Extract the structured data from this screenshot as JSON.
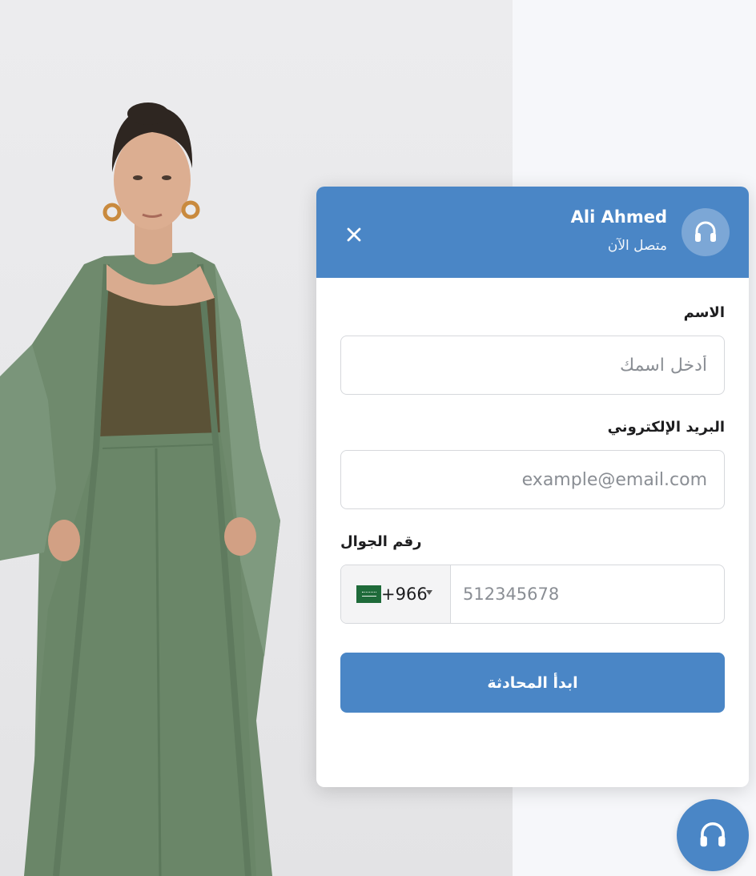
{
  "photo": {
    "icon": "model-photo",
    "colors": {
      "background": "#e8e8ea",
      "garment": "#6f8a6d",
      "top": "#5b5237",
      "skin": "#d7a98c"
    }
  },
  "chat_widget": {
    "header": {
      "agent_name": "Ali Ahmed",
      "agent_status": "متصل الآن",
      "close_icon": "close-icon",
      "avatar_icon": "headset-icon",
      "background_color": "#4a86c6"
    },
    "form": {
      "name": {
        "label": "الاسم",
        "placeholder": "أدخل اسمك",
        "value": ""
      },
      "email": {
        "label": "البريد الإلكتروني",
        "placeholder": "example@email.com",
        "value": ""
      },
      "phone": {
        "label": "رقم الجوال",
        "country_flag": "saudi-arabia-flag",
        "dial_code": "+966",
        "placeholder": "512345678",
        "value": ""
      },
      "submit_label": "ابدأ المحادثة"
    }
  },
  "launcher": {
    "icon": "headset-icon",
    "color": "#4a86c6"
  }
}
